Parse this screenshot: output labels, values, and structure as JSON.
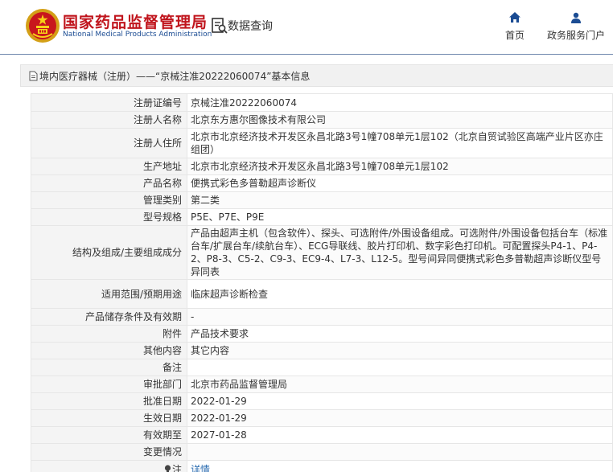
{
  "header": {
    "brand_cn": "国家药品监督管理局",
    "brand_en": "National Medical Products Administration",
    "query_label": "数据查询",
    "nav": [
      {
        "label": "首页",
        "icon": "home-icon"
      },
      {
        "label": "政务服务门户",
        "icon": "user-icon"
      }
    ]
  },
  "breadcrumb": {
    "text": "境内医疗器械（注册）——“京械注准20222060074”基本信息",
    "icon": "document-icon"
  },
  "record": {
    "rows": [
      {
        "label": "注册证编号",
        "value": "京械注准20222060074"
      },
      {
        "label": "注册人名称",
        "value": "北京东方惠尔图像技术有限公司"
      },
      {
        "label": "注册人住所",
        "value": "北京市北京经济技术开发区永昌北路3号1幢708单元1层102（北京自贸试验区高端产业片区亦庄组团）"
      },
      {
        "label": "生产地址",
        "value": "北京市北京经济技术开发区永昌北路3号1幢708单元1层102"
      },
      {
        "label": "产品名称",
        "value": "便携式彩色多普勒超声诊断仪"
      },
      {
        "label": "管理类别",
        "value": "第二类"
      },
      {
        "label": "型号规格",
        "value": "P5E、P7E、P9E"
      },
      {
        "label": "结构及组成/主要组成成分",
        "value": "产品由超声主机（包含软件）、探头、可选附件/外围设备组成。可选附件/外围设备包括台车（标准台车/扩展台车/续航台车）、ECG导联线、胶片打印机、数字彩色打印机。可配置探头P4-1、P4-2、P8-3、C5-2、C9-3、EC9-4、L7-3、L12-5。型号间异同便携式彩色多普勒超声诊断仪型号异同表"
      },
      {
        "label": "适用范围/预期用途",
        "value": "临床超声诊断检查"
      },
      {
        "label": "产品储存条件及有效期",
        "value": "-"
      },
      {
        "label": "附件",
        "value": "产品技术要求"
      },
      {
        "label": "其他内容",
        "value": "其它内容"
      },
      {
        "label": "备注",
        "value": ""
      },
      {
        "label": "审批部门",
        "value": "北京市药品监督管理局"
      },
      {
        "label": "批准日期",
        "value": "2022-01-29"
      },
      {
        "label": "生效日期",
        "value": "2022-01-29"
      },
      {
        "label": "有效期至",
        "value": "2027-01-28"
      },
      {
        "label": "变更情况",
        "value": ""
      }
    ],
    "note_label": "注",
    "note_link": "详情",
    "note_icon": "lightbulb-icon"
  },
  "colors": {
    "brand_red": "#c0141c",
    "brand_blue": "#1b4c93",
    "link_blue": "#2b6cb0",
    "label_bg": "#f4f4f4"
  }
}
